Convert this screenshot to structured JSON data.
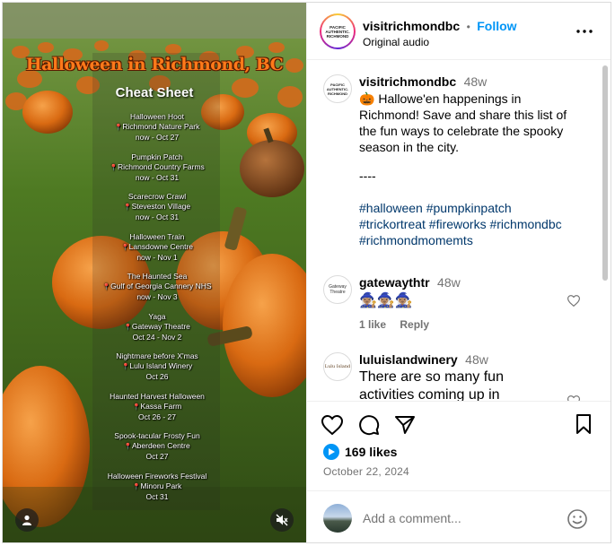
{
  "poster": {
    "title": "Halloween in Richmond, BC",
    "subtitle": "Cheat Sheet",
    "events": [
      {
        "name": "Halloween Hoot",
        "location": "Richmond Nature Park",
        "dates": "now - Oct 27"
      },
      {
        "name": "Pumpkin Patch",
        "location": "Richmond Country Farms",
        "dates": "now - Oct 31"
      },
      {
        "name": "Scarecrow Crawl",
        "location": "Steveston Village",
        "dates": "now - Oct 31"
      },
      {
        "name": "Halloween Train",
        "location": "Lansdowne Centre",
        "dates": "now - Nov 1"
      },
      {
        "name": "The Haunted Sea",
        "location": "Gulf of Georgia Cannery NHS",
        "dates": "now - Nov 3"
      },
      {
        "name": "Yaga",
        "location": "Gateway Theatre",
        "dates": "Oct 24 - Nov 2"
      },
      {
        "name": "Nightmare before X'mas",
        "location": "Lulu Island Winery",
        "dates": "Oct 26"
      },
      {
        "name": "Haunted Harvest Halloween",
        "location": "Kassa Farm",
        "dates": "Oct 26 - 27"
      },
      {
        "name": "Spook-tacular Frosty Fun",
        "location": "Aberdeen Centre",
        "dates": "Oct 27"
      },
      {
        "name": "Halloween Fireworks Festival",
        "location": "Minoru Park",
        "dates": "Oct 31"
      }
    ]
  },
  "header": {
    "username": "visitrichmondbc",
    "separator": "•",
    "follow_label": "Follow",
    "audio": "Original audio",
    "avatar_logo": "PACIFIC AUTHENTIC. RICHMOND"
  },
  "caption": {
    "username": "visitrichmondbc",
    "time": "48w",
    "emoji": "🎃",
    "text": " Hallowe'en happenings in Richmond! Save and share this list of the fun ways to celebrate the spooky season in the city.",
    "divider": "----",
    "hashtags": "#halloween #pumpkinpatch #trickortreat #fireworks #richmondbc #richmondmomemts"
  },
  "comments": [
    {
      "username": "gatewaythtr",
      "time": "48w",
      "text": "🧙🏽‍♀️🧙🏽‍♀️🧙🏽‍♀️",
      "likes": "1 like",
      "reply": "Reply",
      "avatar": "Gateway Theatre"
    },
    {
      "username": "luluislandwinery",
      "time": "48w",
      "text": "There are so many fun activities coming up in",
      "avatar": "Lulu Island"
    }
  ],
  "post": {
    "likes": "169 likes",
    "date": "October 22, 2024"
  },
  "add_comment": {
    "placeholder": "Add a comment..."
  },
  "colors": {
    "accent": "#0095f6",
    "hashtag": "#00376b",
    "poster_title": "#ff7a1a"
  }
}
